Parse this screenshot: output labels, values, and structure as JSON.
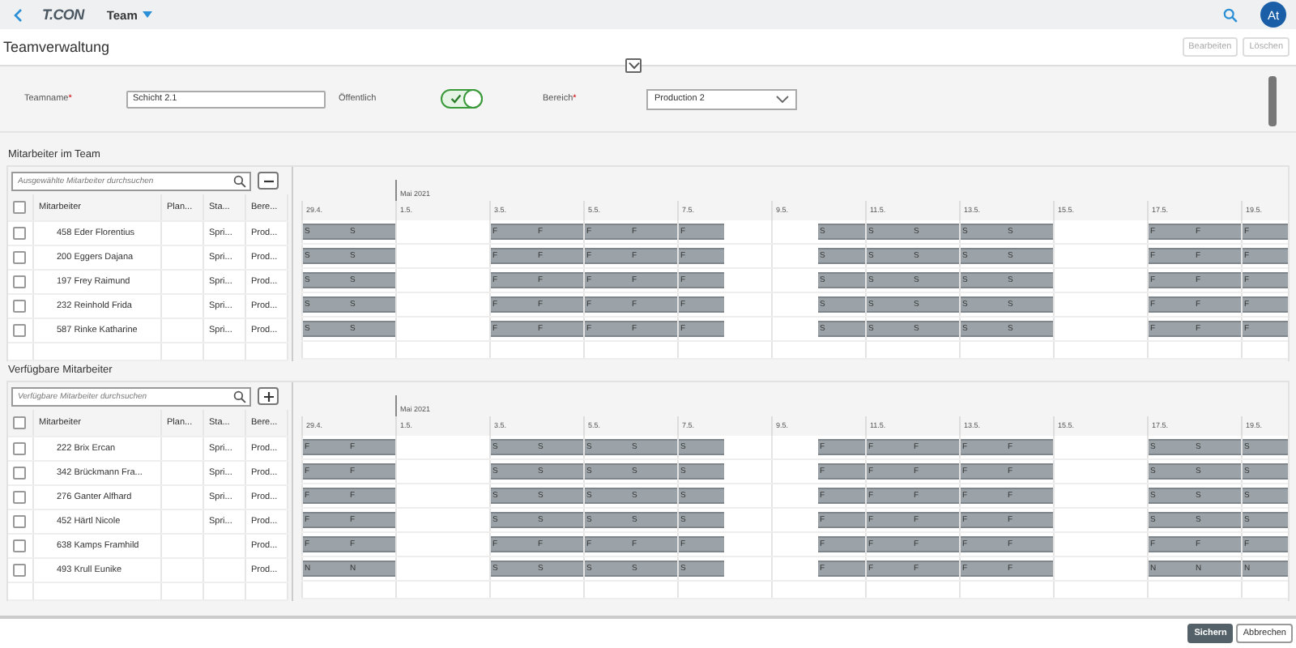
{
  "app": {
    "logo": "T.CON",
    "menu": "Team",
    "avatar": "At"
  },
  "page": {
    "title": "Teamverwaltung",
    "actions": [
      {
        "label": "Bearbeiten",
        "disabled": true
      },
      {
        "label": "Löschen",
        "disabled": true
      }
    ]
  },
  "form": {
    "teamname": {
      "label": "Teamname",
      "required_mark": "*",
      "value": "Schicht 2.1"
    },
    "public": {
      "label": "Öffentlich",
      "on": true
    },
    "area": {
      "label": "Bereich",
      "required_mark": "*",
      "value": "Production 2"
    }
  },
  "sections": [
    {
      "title": "Mitarbeiter im Team",
      "search": {
        "placeholder": "Ausgewählte Mitarbeiter durchsuchen"
      },
      "action": {
        "kind": "remove"
      },
      "columns": [
        "Mitarbeiter",
        "Plan...",
        "Sta...",
        "Bere..."
      ],
      "header_checked": false,
      "month": "Mai 2021",
      "day_labels": [
        "29.4.",
        "1.5.",
        "3.5.",
        "5.5.",
        "7.5.",
        "9.5.",
        "11.5.",
        "13.5.",
        "15.5.",
        "17.5.",
        "19.5."
      ],
      "rows": [
        {
          "checked": false,
          "name": "458 Eder Florentius",
          "status": "Spri...",
          "area": "Prod...",
          "blocks": [
            [
              "S",
              "S"
            ],
            [
              "F",
              "F",
              "F",
              "F",
              "F"
            ],
            [
              "S",
              "S",
              "S",
              "S",
              "S"
            ],
            [
              "F",
              "F",
              "F"
            ]
          ]
        },
        {
          "checked": false,
          "name": "200 Eggers Dajana",
          "status": "Spri...",
          "area": "Prod...",
          "blocks": [
            [
              "S",
              "S"
            ],
            [
              "F",
              "F",
              "F",
              "F",
              "F"
            ],
            [
              "S",
              "S",
              "S",
              "S",
              "S"
            ],
            [
              "F",
              "F",
              "F"
            ]
          ]
        },
        {
          "checked": false,
          "name": "197 Frey Raimund",
          "status": "Spri...",
          "area": "Prod...",
          "blocks": [
            [
              "S",
              "S"
            ],
            [
              "F",
              "F",
              "F",
              "F",
              "F"
            ],
            [
              "S",
              "S",
              "S",
              "S",
              "S"
            ],
            [
              "F",
              "F",
              "F"
            ]
          ]
        },
        {
          "checked": false,
          "name": "232 Reinhold Frida",
          "status": "Spri...",
          "area": "Prod...",
          "blocks": [
            [
              "S",
              "S"
            ],
            [
              "F",
              "F",
              "F",
              "F",
              "F"
            ],
            [
              "S",
              "S",
              "S",
              "S",
              "S"
            ],
            [
              "F",
              "F",
              "F"
            ]
          ]
        },
        {
          "checked": false,
          "name": "587 Rinke Katharine",
          "status": "Spri...",
          "area": "Prod...",
          "blocks": [
            [
              "S",
              "S"
            ],
            [
              "F",
              "F",
              "F",
              "F",
              "F"
            ],
            [
              "S",
              "S",
              "S",
              "S",
              "S"
            ],
            [
              "F",
              "F",
              "F"
            ]
          ]
        }
      ]
    },
    {
      "title": "Verfügbare Mitarbeiter",
      "search": {
        "placeholder": "Verfügbare Mitarbeiter durchsuchen"
      },
      "action": {
        "kind": "add"
      },
      "columns": [
        "Mitarbeiter",
        "Plan...",
        "Sta...",
        "Bere..."
      ],
      "header_checked": false,
      "month": "Mai 2021",
      "day_labels": [
        "29.4.",
        "1.5.",
        "3.5.",
        "5.5.",
        "7.5.",
        "9.5.",
        "11.5.",
        "13.5.",
        "15.5.",
        "17.5.",
        "19.5."
      ],
      "rows": [
        {
          "checked": false,
          "name": "222 Brix Ercan",
          "status": "Spri...",
          "area": "Prod...",
          "blocks": [
            [
              "F",
              "F"
            ],
            [
              "S",
              "S",
              "S",
              "S",
              "S"
            ],
            [
              "F",
              "F",
              "F",
              "F",
              "F"
            ],
            [
              "S",
              "S",
              "S"
            ]
          ]
        },
        {
          "checked": false,
          "name": "342 Brückmann Fra...",
          "status": "Spri...",
          "area": "Prod...",
          "blocks": [
            [
              "F",
              "F"
            ],
            [
              "S",
              "S",
              "S",
              "S",
              "S"
            ],
            [
              "F",
              "F",
              "F",
              "F",
              "F"
            ],
            [
              "S",
              "S",
              "S"
            ]
          ]
        },
        {
          "checked": false,
          "name": "276 Ganter Alfhard",
          "status": "Spri...",
          "area": "Prod...",
          "blocks": [
            [
              "F",
              "F"
            ],
            [
              "S",
              "S",
              "S",
              "S",
              "S"
            ],
            [
              "F",
              "F",
              "F",
              "F",
              "F"
            ],
            [
              "S",
              "S",
              "S"
            ]
          ]
        },
        {
          "checked": false,
          "name": "452 Härtl Nicole",
          "status": "Spri...",
          "area": "Prod...",
          "blocks": [
            [
              "F",
              "F"
            ],
            [
              "S",
              "S",
              "S",
              "S",
              "S"
            ],
            [
              "F",
              "F",
              "F",
              "F",
              "F"
            ],
            [
              "S",
              "S",
              "S"
            ]
          ]
        },
        {
          "checked": false,
          "name": "638 Kamps Framhild",
          "area": "Prod...",
          "blocks": [
            [
              "F",
              "F"
            ],
            [
              "F",
              "F",
              "F",
              "F",
              "F"
            ],
            [
              "F",
              "F",
              "F",
              "F",
              "F"
            ],
            [
              "F",
              "F",
              "F"
            ]
          ]
        },
        {
          "checked": false,
          "name": "493 Krull Eunike",
          "area": "Prod...",
          "blocks": [
            [
              "N",
              "N"
            ],
            [
              "S",
              "S",
              "S",
              "S",
              "S"
            ],
            [
              "F",
              "F",
              "F",
              "F",
              "F"
            ],
            [
              "N",
              "N",
              "N"
            ]
          ]
        }
      ]
    }
  ],
  "footer": {
    "buttons": [
      {
        "label": "Sichern",
        "kind": "primary"
      },
      {
        "label": "Abbrechen",
        "kind": "secondary"
      }
    ]
  }
}
